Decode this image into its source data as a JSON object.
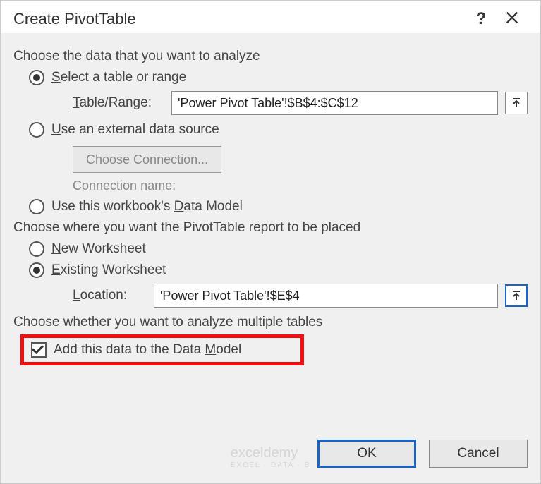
{
  "title": "Create PivotTable",
  "section1": {
    "label": "Choose the data that you want to analyze",
    "opt_select": "Select a table or range",
    "table_range_label": "Table/Range:",
    "table_range_value": "'Power Pivot Table'!$B$4:$C$12",
    "opt_external": "Use an external data source",
    "choose_conn_btn": "Choose Connection...",
    "conn_name_label": "Connection name:",
    "opt_datamodel": "Use this workbook's Data Model"
  },
  "section2": {
    "label": "Choose where you want the PivotTable report to be placed",
    "opt_new": "New Worksheet",
    "opt_existing": "Existing Worksheet",
    "location_label": "Location:",
    "location_value": "'Power Pivot Table'!$E$4"
  },
  "section3": {
    "label": "Choose whether you want to analyze multiple tables",
    "add_data_model": "Add this data to the Data Model"
  },
  "buttons": {
    "ok": "OK",
    "cancel": "Cancel"
  },
  "watermark": {
    "brand": "exceldemy",
    "tag": "EXCEL · DATA · B"
  }
}
